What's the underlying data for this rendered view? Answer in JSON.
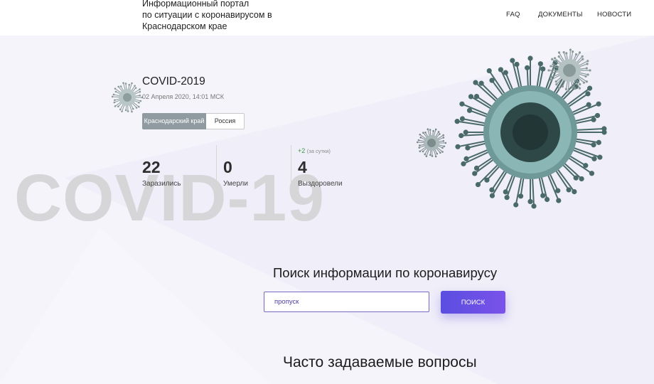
{
  "header": {
    "logo_lines": [
      "Информационный портал",
      "по ситуации с коронавирусом в",
      "Краснодарском крае"
    ],
    "nav": [
      {
        "label": "FAQ"
      },
      {
        "label": "ДОКУМЕНТЫ"
      },
      {
        "label": "НОВОСТИ"
      }
    ]
  },
  "hero": {
    "watermark": "COVID-19",
    "title": "COVID-2019",
    "date": "02 Апреля 2020, 14:01 МСК",
    "tabs": [
      {
        "label": "Краснодарский край",
        "active": true
      },
      {
        "label": "Россия",
        "active": false
      }
    ],
    "stats": [
      {
        "value": "22",
        "label": "Заразились"
      },
      {
        "value": "0",
        "label": "Умерли"
      },
      {
        "value": "4",
        "label": "Выздоровели",
        "delta": "+2",
        "delta_note": "(за сутки)"
      }
    ]
  },
  "search": {
    "title": "Поиск информации по коронавирусу",
    "input_value": "пропуск",
    "button_label": "ПОИСК"
  },
  "faq": {
    "title": "Часто задаваемые вопросы"
  },
  "colors": {
    "accent": "#6a50e6",
    "tab_active": "#8f9ba1",
    "positive": "#3a9a3a"
  }
}
